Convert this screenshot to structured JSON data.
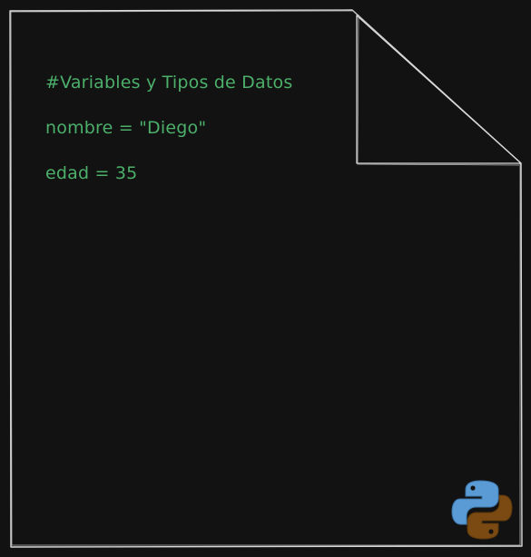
{
  "code_lines": [
    "#Variables y Tipos de Datos",
    "nombre = \"Diego\"",
    "edad = 35"
  ],
  "logo": {
    "icon": "python-logo-icon",
    "colors": {
      "blue": "#5b9bd5",
      "brown": "#7a4a12"
    }
  },
  "colors": {
    "background": "#121212",
    "outline": "#d9d9d9",
    "code_text": "#4caf6a"
  }
}
